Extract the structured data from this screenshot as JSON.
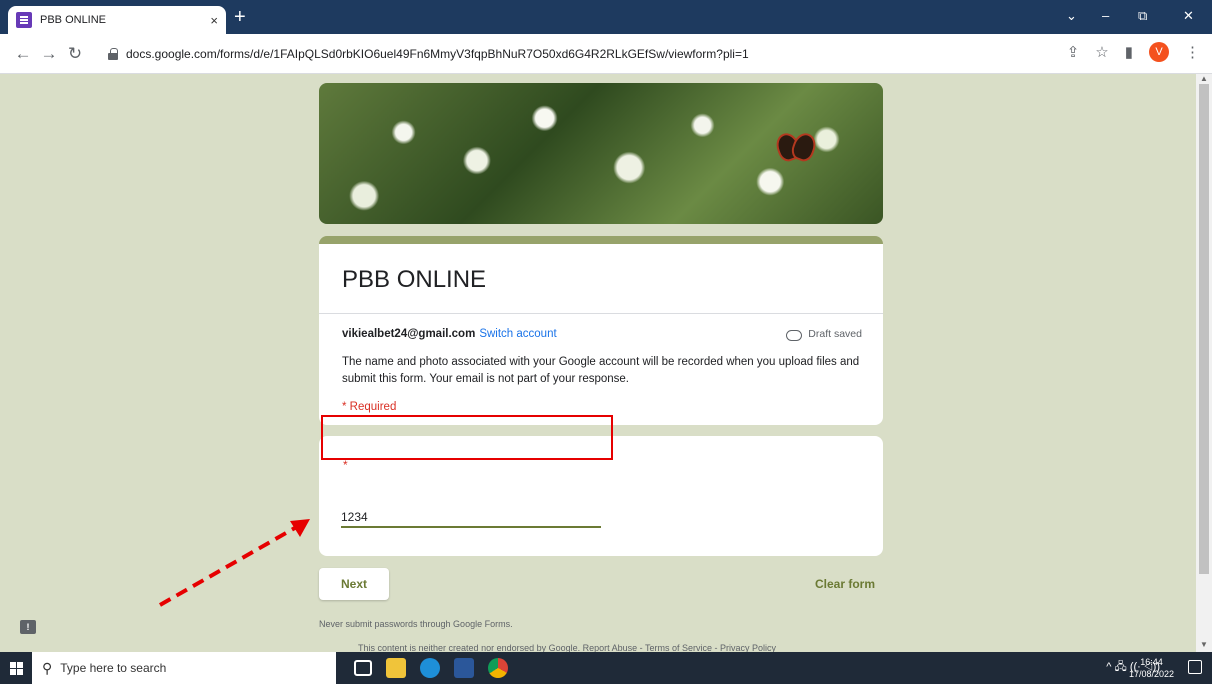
{
  "browser": {
    "tab_title": "PBB ONLINE",
    "tab_close": "×",
    "new_tab": "+",
    "url": "docs.google.com/forms/d/e/1FAIpQLSd0rbKIO6uel49Fn6MmyV3fqpBhNuR7O50xd6G4R2RLkGEfSw/viewform?pli=1",
    "profile_initial": "V",
    "window_controls": [
      "⌄",
      "–",
      "⧉",
      "✕"
    ],
    "nav": {
      "back": "←",
      "forward": "→",
      "reload": "↻"
    }
  },
  "form": {
    "title": "PBB ONLINE",
    "account_email": "vikiealbet24@gmail.com",
    "switch_account": "Switch account",
    "draft_status": "Draft saved",
    "description": "The name and photo associated with your Google account will be recorded when you upload files and submit this form. Your email is not part of your response.",
    "required_note": "* Required",
    "question_required_mark": "*",
    "answer_value": "1234",
    "next_button": "Next",
    "clear_form": "Clear form",
    "password_warning": "Never submit passwords through Google Forms.",
    "footer": "This content is neither created nor endorsed by Google. Report Abuse - Terms of Service - Privacy Policy"
  },
  "taskbar": {
    "search_placeholder": "Type here to search",
    "time": "16:44",
    "date": "17/08/2022",
    "tray_icons": "^ 🖧 ((· ◁))"
  },
  "colors": {
    "page_bg": "#d9dec7",
    "accent": "#6b7a34",
    "title_bar": "#1e3a5f",
    "annotation_red": "#e60000"
  }
}
